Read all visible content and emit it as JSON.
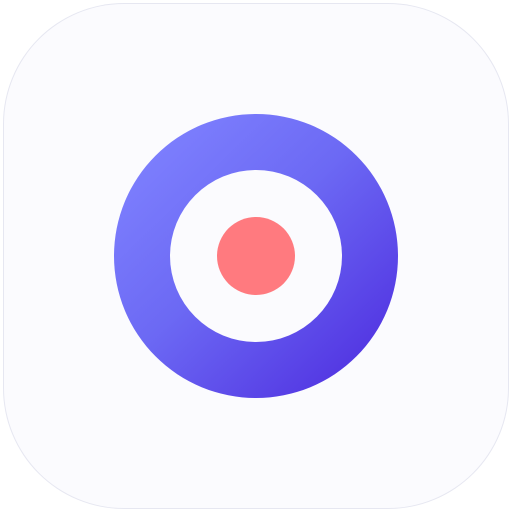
{
  "icon": {
    "name": "target-app-icon",
    "symbol": "target-icon"
  },
  "colors": {
    "tile_background": "#fbfbfe",
    "ring_gradient_start": "#7f82ff",
    "ring_gradient_end": "#4f2fe0",
    "inner_fill": "#fbfbfe",
    "center_dot": "#ff7a7f"
  }
}
